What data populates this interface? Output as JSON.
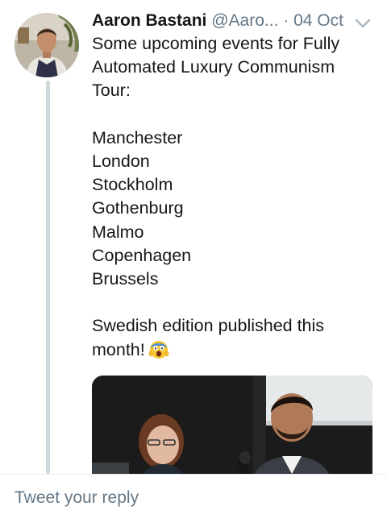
{
  "tweet": {
    "author_name": "Aaron Bastani",
    "handle": "@Aaro...",
    "separator": "·",
    "date": "04 Oct",
    "text_lines": [
      "Some upcoming events for Fully",
      "Automated Luxury Communism",
      "Tour:",
      "",
      "Manchester",
      "London",
      "Stockholm",
      "Gothenburg",
      "Malmo",
      "Copenhagen",
      "Brussels",
      "",
      "Swedish edition published this",
      "month!"
    ],
    "emoji": "screaming-face-emoji",
    "caret_icon": "chevron-down-icon"
  },
  "reply": {
    "placeholder": "Tweet your reply"
  },
  "colors": {
    "text": "#14171a",
    "secondary": "#657786",
    "thread_line": "#cfd9de"
  }
}
